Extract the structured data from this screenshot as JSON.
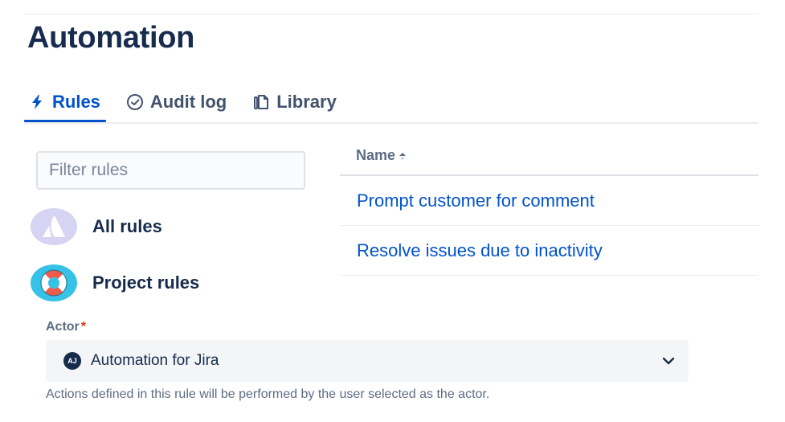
{
  "page": {
    "title": "Automation"
  },
  "tabs": [
    {
      "label": "Rules",
      "icon": "lightning-icon",
      "active": true
    },
    {
      "label": "Audit log",
      "icon": "check-circle-icon",
      "active": false
    },
    {
      "label": "Library",
      "icon": "copy-icon",
      "active": false
    }
  ],
  "filter": {
    "placeholder": "Filter rules",
    "value": ""
  },
  "scopes": [
    {
      "label": "All rules",
      "icon": "atlassian-logo-icon"
    },
    {
      "label": "Project rules",
      "icon": "lifebuoy-icon"
    }
  ],
  "table": {
    "header_name": "Name",
    "sort": "ascending",
    "rows": [
      {
        "name": "Prompt customer for comment"
      },
      {
        "name": "Resolve issues due to inactivity"
      }
    ]
  },
  "actor": {
    "label": "Actor",
    "required_marker": "*",
    "value": "Automation for Jira",
    "avatar_initials": "AJ",
    "helper_text": "Actions defined in this rule will be performed by the user selected as the actor."
  },
  "colors": {
    "accent": "#0052CC",
    "text_primary": "#172B4D",
    "text_subtle": "#5E6C84",
    "required": "#DE350B"
  }
}
